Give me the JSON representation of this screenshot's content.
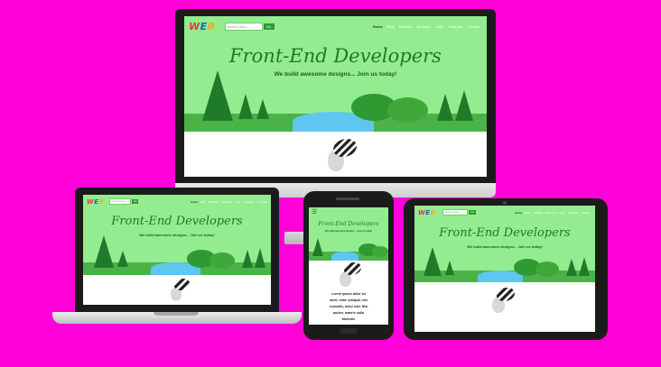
{
  "site": {
    "logo": {
      "w": "W",
      "e": "E",
      "b": "B"
    },
    "search_placeholder": "search here...",
    "search_button": "Go",
    "nav": [
      "Home",
      "Blog",
      "Portfolio",
      "Reviews",
      "Login",
      "Features",
      "Contact"
    ],
    "hero_title": "Front-End Developers",
    "hero_subtitle": "We build awesome designs... Join us today!",
    "phone_text": [
      "Lorem ipsum dolor sit",
      "amet, vitae volutpat, nisl",
      "convallis, dolor wisi. Nisi",
      "auctor, mauris nulla",
      "Molestie"
    ]
  },
  "colors": {
    "background": "#ff00d8",
    "site_green": "#93ec8f",
    "dark_green": "#1f7a1f"
  }
}
